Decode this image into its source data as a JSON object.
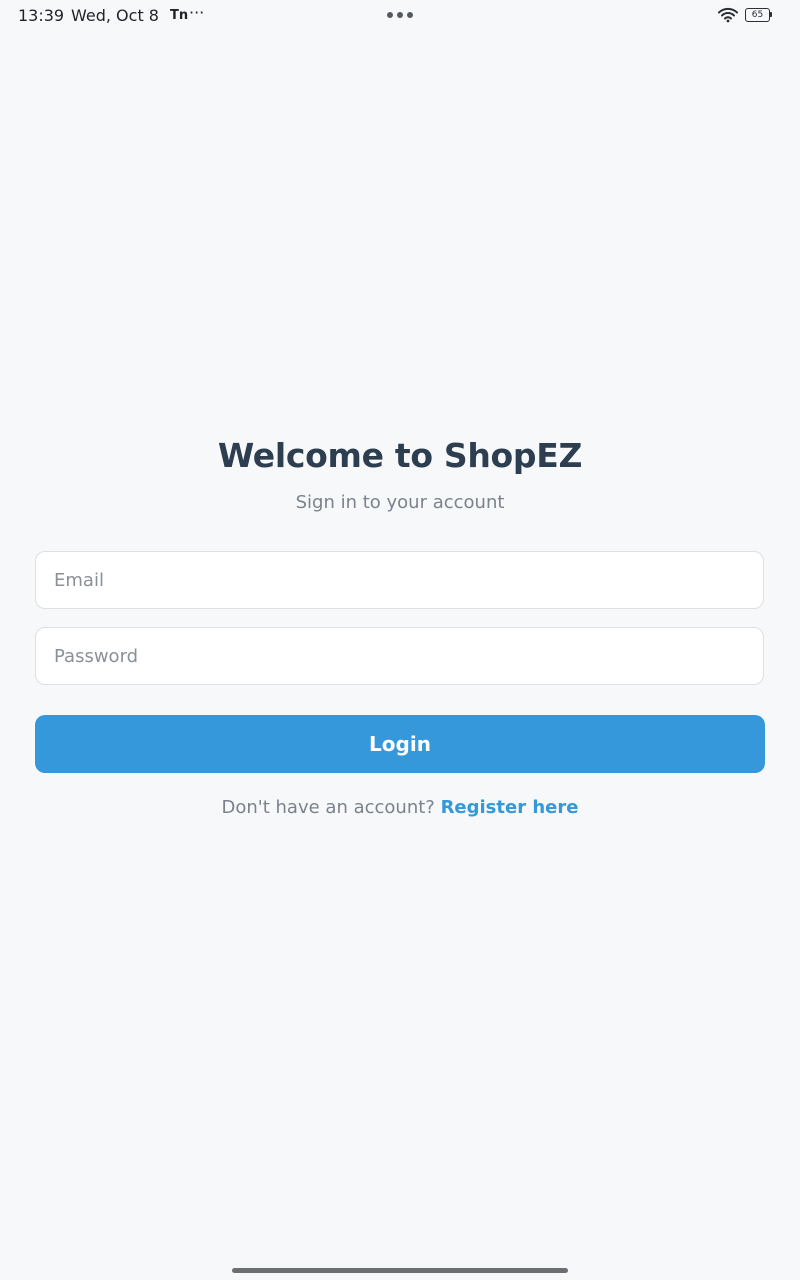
{
  "status_bar": {
    "time": "13:39",
    "date": "Wed, Oct 8",
    "app_icon_text": "Tn",
    "more_indicator": "···",
    "battery_level": "65",
    "icons": [
      "wifi-icon",
      "battery-icon"
    ]
  },
  "login": {
    "title": "Welcome to ShopEZ",
    "subtitle": "Sign in to your account",
    "email_placeholder": "Email",
    "email_value": "",
    "password_placeholder": "Password",
    "password_value": "",
    "login_label": "Login",
    "register_prompt": "Don't have an account? ",
    "register_link": "Register here"
  },
  "colors": {
    "background": "#f7f8fa",
    "title": "#2c3e50",
    "muted_text": "#7a828c",
    "accent": "#3498db",
    "button_text": "#ffffff"
  }
}
